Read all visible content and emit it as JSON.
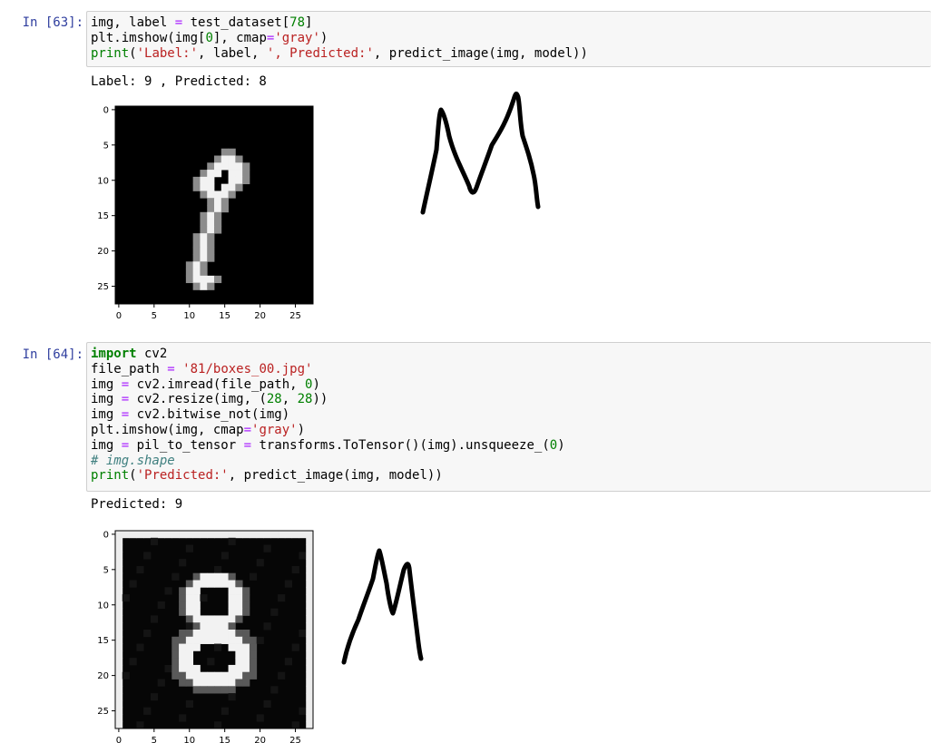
{
  "cells": [
    {
      "prompt": "In [63]:",
      "output": "Label: 9 , Predicted: 8",
      "code_tokens": [
        [
          [
            "img, label ",
            ""
          ],
          [
            "=",
            "op"
          ],
          [
            " test_dataset[",
            ""
          ],
          [
            "78",
            "num"
          ],
          [
            "]",
            ""
          ]
        ],
        [
          [
            "plt.imshow(img[",
            ""
          ],
          [
            "0",
            "num"
          ],
          [
            "], cmap",
            ""
          ],
          [
            "=",
            "op"
          ],
          [
            "'gray'",
            "str"
          ],
          [
            ")",
            ""
          ]
        ],
        [
          [
            "print",
            "bi"
          ],
          [
            "(",
            ""
          ],
          [
            "'Label:'",
            "str"
          ],
          [
            ", label, ",
            ""
          ],
          [
            "', Predicted:'",
            "str"
          ],
          [
            ", predict_image(img, model))",
            ""
          ]
        ]
      ]
    },
    {
      "prompt": "In [64]:",
      "output": "Predicted: 9",
      "code_tokens": [
        [
          [
            "import",
            "kw"
          ],
          [
            " cv2",
            ""
          ]
        ],
        [
          [
            "file_path ",
            ""
          ],
          [
            "=",
            "op"
          ],
          [
            " ",
            ""
          ],
          [
            "'81/boxes_00.jpg'",
            "str"
          ]
        ],
        [
          [
            "img ",
            ""
          ],
          [
            "=",
            "op"
          ],
          [
            " cv2.imread(file_path, ",
            ""
          ],
          [
            "0",
            "num"
          ],
          [
            ")",
            ""
          ]
        ],
        [
          [
            "img ",
            ""
          ],
          [
            "=",
            "op"
          ],
          [
            " cv2.resize(img, (",
            ""
          ],
          [
            "28",
            "num"
          ],
          [
            ", ",
            ""
          ],
          [
            "28",
            "num"
          ],
          [
            "))",
            ""
          ]
        ],
        [
          [
            "img ",
            ""
          ],
          [
            "=",
            "op"
          ],
          [
            " cv2.bitwise_not(img)",
            ""
          ]
        ],
        [
          [
            "plt.imshow(img, cmap",
            ""
          ],
          [
            "=",
            "op"
          ],
          [
            "'gray'",
            "str"
          ],
          [
            ")",
            ""
          ]
        ],
        [
          [
            "img ",
            ""
          ],
          [
            "=",
            "op"
          ],
          [
            " pil_to_tensor ",
            ""
          ],
          [
            "=",
            "op"
          ],
          [
            " transforms.ToTensor()(img).unsqueeze_(",
            ""
          ],
          [
            "0",
            "num"
          ],
          [
            ")",
            ""
          ]
        ],
        [
          [
            "# img.shape",
            "cmt"
          ]
        ],
        [
          [
            "print",
            "bi"
          ],
          [
            "(",
            ""
          ],
          [
            "'Predicted:'",
            "str"
          ],
          [
            ", predict_image(img, model))",
            ""
          ]
        ]
      ]
    }
  ],
  "plots": [
    {
      "yticks": [
        "0",
        "5",
        "10",
        "15",
        "20",
        "25"
      ],
      "xticks": [
        "0",
        "5",
        "10",
        "15",
        "20",
        "25"
      ],
      "image": "digit-9-mnist"
    },
    {
      "yticks": [
        "0",
        "5",
        "10",
        "15",
        "20",
        "25"
      ],
      "xticks": [
        "0",
        "5",
        "10",
        "15",
        "20",
        "25"
      ],
      "image": "digit-8-webcam"
    }
  ],
  "colors": {
    "prompt": "#303f9f",
    "keyword": "#008000",
    "string": "#ba2121",
    "operator": "#aa22ff",
    "comment": "#408080"
  }
}
